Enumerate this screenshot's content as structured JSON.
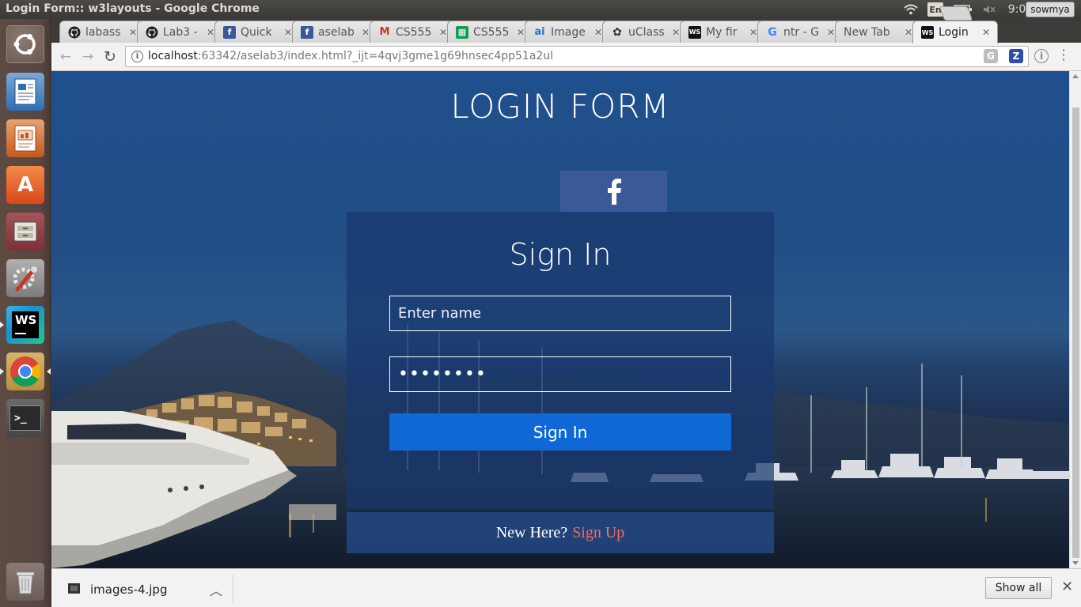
{
  "window": {
    "title": "Login Form:: w3layouts - Google Chrome"
  },
  "system_tray": {
    "language": "En",
    "clock": "9:06 PM"
  },
  "launcher": {
    "items": [
      {
        "name": "ubuntu-dash"
      },
      {
        "name": "libreoffice-writer"
      },
      {
        "name": "libreoffice-impress"
      },
      {
        "name": "ubuntu-software"
      },
      {
        "name": "files"
      },
      {
        "name": "system-settings"
      },
      {
        "name": "webstorm"
      },
      {
        "name": "google-chrome"
      },
      {
        "name": "terminal"
      },
      {
        "name": "trash"
      }
    ],
    "webstorm_label": "WS",
    "software_label": "A"
  },
  "tabs": [
    {
      "label": "labass",
      "icon": "github-icon",
      "favicon_text": "",
      "color": "#222222"
    },
    {
      "label": "Lab3 -",
      "icon": "github-icon",
      "favicon_text": "",
      "color": "#222222"
    },
    {
      "label": "Quick",
      "icon": "facebook-icon",
      "favicon_text": "f",
      "color": "#3b5998"
    },
    {
      "label": "aselab",
      "icon": "facebook-icon",
      "favicon_text": "f",
      "color": "#3b5998"
    },
    {
      "label": "CS555",
      "icon": "gmail-icon",
      "favicon_text": "M",
      "color": "#d93025"
    },
    {
      "label": "CS555",
      "icon": "sheets-icon",
      "favicon_text": "▦",
      "color": "#0f9d58"
    },
    {
      "label": "Image",
      "icon": "ai-icon",
      "favicon_text": "ai",
      "color": "#2a74d6"
    },
    {
      "label": "uClass",
      "icon": "uclass-icon",
      "favicon_text": "✿",
      "color": "#333333"
    },
    {
      "label": "My fir",
      "icon": "webstorm-icon",
      "favicon_text": "WS",
      "color": "#111111"
    },
    {
      "label": "ntr - G",
      "icon": "google-icon",
      "favicon_text": "G",
      "color": "#4285f4"
    },
    {
      "label": "New Tab",
      "icon": "",
      "favicon_text": "",
      "color": ""
    },
    {
      "label": "Login",
      "icon": "webstorm-icon",
      "favicon_text": "WS",
      "color": "#111111",
      "active": true
    }
  ],
  "profile": {
    "name": "sowmya"
  },
  "omnibox": {
    "host": "localhost",
    "rest": ":63342/aselab3/index.html?_ijt=4qvj3gme1g69hnsec4pp51a2ul"
  },
  "extensions": {
    "g_label": "G",
    "z_label": "Z",
    "circle_label": "i"
  },
  "page": {
    "heading": "LOGIN FORM",
    "facebook_icon": "facebook-f-icon",
    "signin_title": "Sign In",
    "name_placeholder": "Enter name",
    "password_mask": "••••••••",
    "signin_button": "Sign In",
    "signup_prompt": "New Here?",
    "signup_link": "Sign Up",
    "colors": {
      "facebook": "#3b5998",
      "button": "#1068d6",
      "signup_link": "#f26b6b"
    }
  },
  "download_shelf": {
    "filename": "images-4.jpg",
    "show_all": "Show all"
  }
}
